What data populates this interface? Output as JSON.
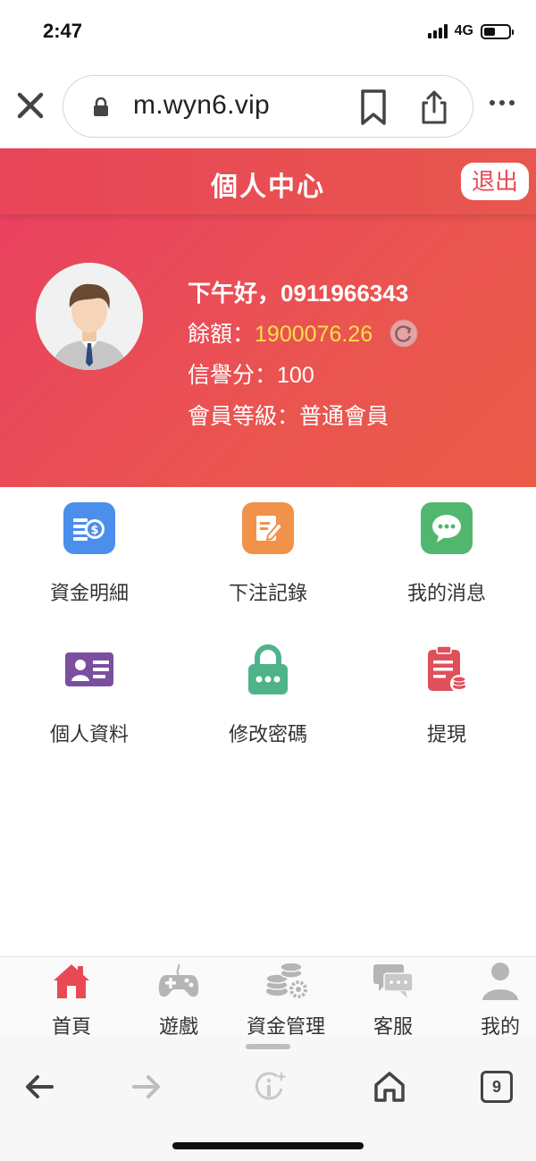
{
  "status": {
    "time": "2:47",
    "network": "4G"
  },
  "browser": {
    "url": "m.wyn6.vip",
    "tab_count": "9"
  },
  "header": {
    "title": "個人中心",
    "logout": "退出"
  },
  "profile": {
    "greeting": "下午好，0911966343",
    "balance_label": "餘額：",
    "balance_value": "1900076.26",
    "credit_label": "信譽分：",
    "credit_value": "100",
    "level_label": "會員等級：",
    "level_value": "普通會員"
  },
  "menu": {
    "items": [
      {
        "label": "資金明細",
        "icon": "money-stack-icon",
        "color": "#4a8fec"
      },
      {
        "label": "下注記錄",
        "icon": "edit-note-icon",
        "color": "#f0924a"
      },
      {
        "label": "我的消息",
        "icon": "chat-bubble-icon",
        "color": "#52b76e"
      },
      {
        "label": "個人資料",
        "icon": "id-card-icon",
        "color": "#7b4fa0"
      },
      {
        "label": "修改密碼",
        "icon": "lock-icon",
        "color": "#4fb38a"
      },
      {
        "label": "提現",
        "icon": "withdraw-clipboard-icon",
        "color": "#e0505a"
      }
    ]
  },
  "tabbar": {
    "items": [
      {
        "label": "首頁",
        "icon": "home-icon",
        "active": true
      },
      {
        "label": "遊戲",
        "icon": "gamepad-icon",
        "active": false
      },
      {
        "label": "資金管理",
        "icon": "coins-gear-icon",
        "active": false
      },
      {
        "label": "客服",
        "icon": "chat-icon",
        "active": false
      },
      {
        "label": "我的",
        "icon": "user-icon",
        "active": false
      }
    ]
  },
  "colors": {
    "accent": "#e84a55",
    "balance": "#f7e04a",
    "active_tab": "#e84a55",
    "inactive_tab": "#b5b5b5"
  }
}
